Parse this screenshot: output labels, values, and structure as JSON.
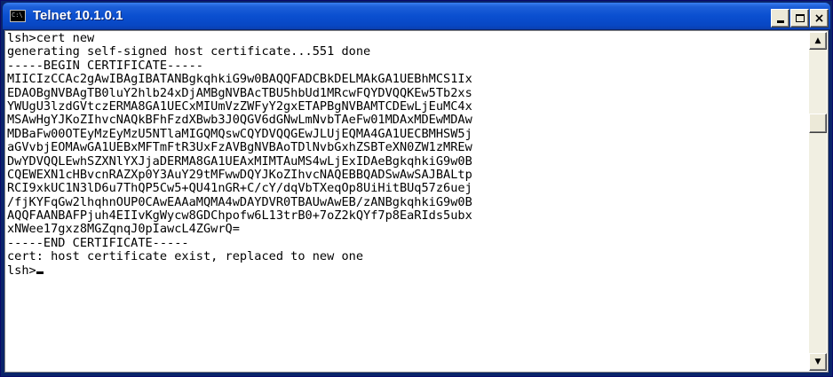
{
  "window": {
    "title": "Telnet 10.1.0.1",
    "icon_name": "console-icon",
    "icon_text": "C:\\"
  },
  "controls": {
    "minimize_icon": "minimize-icon",
    "maximize_icon": "maximize-icon",
    "close_icon": "close-icon",
    "close_glyph": "×"
  },
  "terminal": {
    "lines": [
      "lsh>cert new",
      "generating self-signed host certificate...551 done",
      "-----BEGIN CERTIFICATE-----",
      "MIICIzCCAc2gAwIBAgIBATANBgkqhkiG9w0BAQQFADCBkDELMAkGA1UEBhMCS1Ix",
      "EDAOBgNVBAgTB0luY2hlb24xDjAMBgNVBAcTBU5hbUd1MRcwFQYDVQQKEw5Tb2xs",
      "YWUgU3lzdGVtczERMA8GA1UECxMIUmVzZWFyY2gxETAPBgNVBAMTCDEwLjEuMC4x",
      "MSAwHgYJKoZIhvcNAQkBFhFzdXBwb3J0QGV6dGNwLmNvbTAeFw01MDAxMDEwMDAw",
      "MDBaFw00OTEyMzEyMzU5NTlaMIGQMQswCQYDVQQGEwJLUjEQMA4GA1UECBMHSW5j",
      "aGVvbjEOMAwGA1UEBxMFTmFtR3UxFzAVBgNVBAoTDlNvbGxhZSBTeXN0ZW1zMREw",
      "DwYDVQQLEwhSZXNlYXJjaDERMA8GA1UEAxMIMTAuMS4wLjExIDAeBgkqhkiG9w0B",
      "CQEWEXN1cHBvcnRAZXp0Y3AuY29tMFwwDQYJKoZIhvcNAQEBBQADSwAwSAJBALtp",
      "RCI9xkUC1N3lD6u7ThQP5Cw5+QU41nGR+C/cY/dqVbTXeqOp8UiHitBUq57z6uej",
      "/fjKYFqGw2lhqhnOUP0CAwEAAaMQMA4wDAYDVR0TBAUwAwEB/zANBgkqhkiG9w0B",
      "AQQFAANBAFPjuh4EIIvKgWycw8GDChpofw6L13trB0+7oZ2kQYf7p8EaRIds5ubx",
      "xNWee17gxz8MGZqnqJ0pIawcL4ZGwrQ=",
      "-----END CERTIFICATE-----",
      "cert: host certificate exist, replaced to new one"
    ],
    "prompt": "lsh>"
  },
  "scrollbar": {
    "up_icon": "scroll-up-arrow-icon",
    "down_icon": "scroll-down-arrow-icon",
    "up_glyph": "▲",
    "down_glyph": "▼"
  }
}
